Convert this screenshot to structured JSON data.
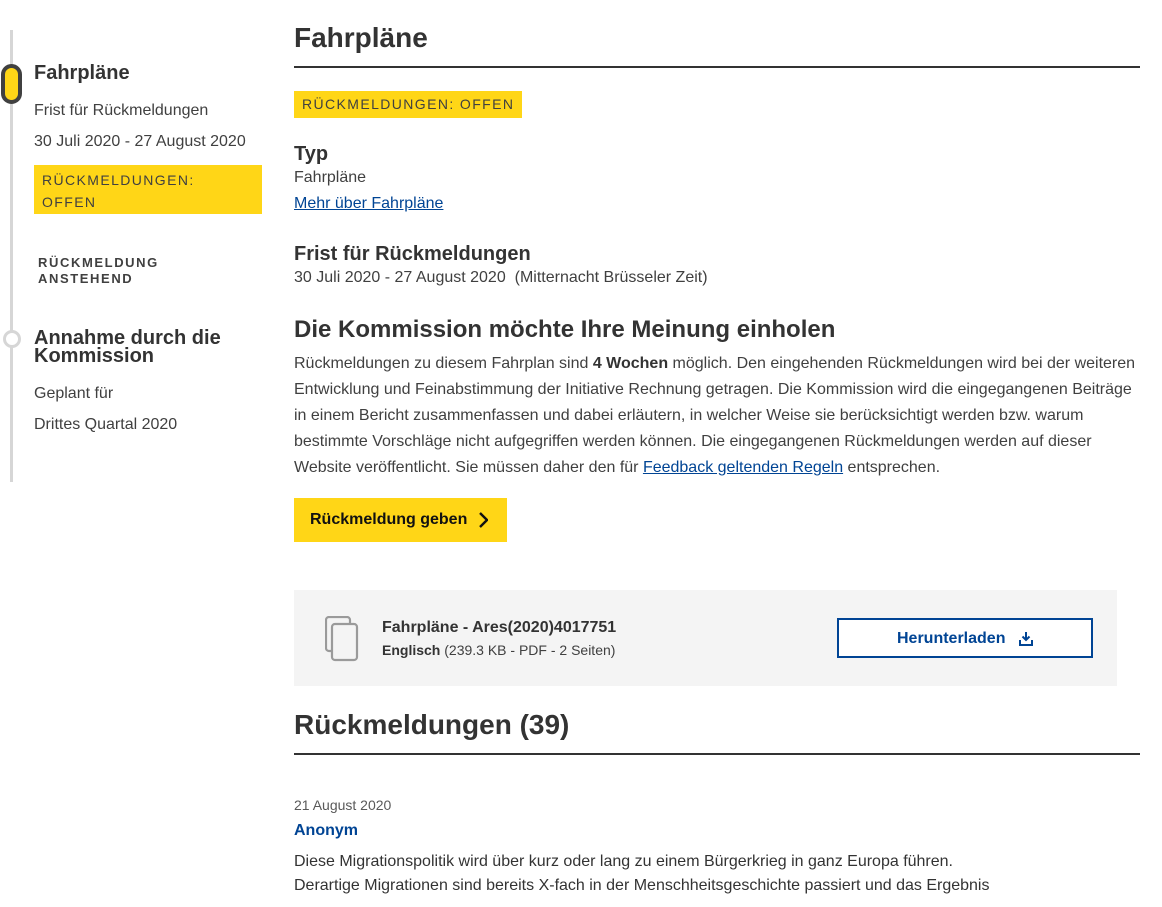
{
  "timeline": {
    "step1": {
      "title": "Fahrpläne",
      "label": "Frist für Rückmeldungen",
      "dates": "30 Juli 2020 - 27 August 2020",
      "badge": "RÜCKMELDUNGEN: OFFEN"
    },
    "pending": "RÜCKMELDUNG ANSTEHEND",
    "step2": {
      "title": "Annahme durch die Kommission",
      "label": "Geplant für",
      "date": "Drittes Quartal 2020"
    }
  },
  "main": {
    "title": "Fahrpläne",
    "status_badge": "RÜCKMELDUNGEN: OFFEN",
    "type": {
      "heading": "Typ",
      "value": "Fahrpläne",
      "link": "Mehr über Fahrpläne"
    },
    "deadline": {
      "heading": "Frist für Rückmeldungen",
      "value": "30 Juli 2020 - 27 August 2020  (Mitternacht Brüsseler Zeit)"
    },
    "opinion": {
      "heading": "Die Kommission möchte Ihre Meinung einholen",
      "text_before": "Rückmeldungen zu diesem Fahrplan sind ",
      "duration": "4 Wochen",
      "text_after": " möglich. Den eingehenden Rückmeldungen wird bei der weiteren Entwicklung und Feinabstimmung der Initiative Rechnung getragen. Die Kommission wird die eingegangenen Beiträge in einem Bericht zusammenfassen und dabei erläutern, in welcher Weise sie berücksichtigt werden bzw. warum bestimmte Vorschläge nicht aufgegriffen werden können. Die eingegangenen Rückmeldungen werden auf dieser Website veröffentlicht. Sie müssen daher den für ",
      "rules_link": "Feedback geltenden Regeln",
      "text_end": " entsprechen."
    },
    "cta_label": "Rückmeldung geben",
    "document": {
      "title": "Fahrpläne - Ares(2020)4017751",
      "language": "Englisch",
      "details": " (239.3 KB - PDF - 2 Seiten)",
      "download_label": "Herunterladen"
    },
    "feedback_heading": "Rückmeldungen (39)",
    "feedback": {
      "date": "21 August 2020",
      "author": "Anonym",
      "text": "Diese Migrationspolitik wird über kurz oder lang zu einem Bürgerkrieg in ganz Europa führen. Derartige Migrationen sind bereits X-fach in der Menschheitsgeschichte passiert und das Ergebnis"
    }
  },
  "colors": {
    "accent_yellow": "#ffd617",
    "link_blue": "#004494",
    "text_dark": "#333333",
    "panel_gray": "#f4f4f4"
  },
  "icons": {
    "cta": "chevron-right-icon",
    "document": "documents-icon",
    "download": "download-icon"
  }
}
